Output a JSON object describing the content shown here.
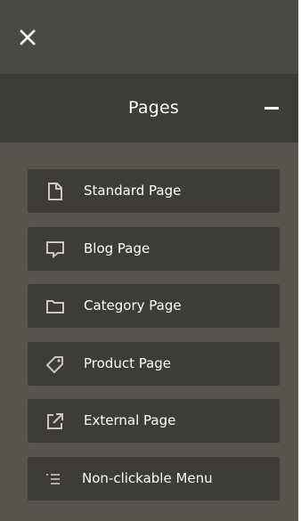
{
  "colors": {
    "panel_bg": "#56544d",
    "topbar_bg": "#4b4943",
    "header_bg": "#3e3c37",
    "item_bg": "#3e3c37",
    "text": "#ffffff",
    "icon": "#c9c7c0"
  },
  "topbar": {
    "close_icon": "close-icon"
  },
  "section": {
    "title": "Pages",
    "toggle_icon": "minus-icon"
  },
  "menu": {
    "items": [
      {
        "label": "Standard Page",
        "icon": "document-icon"
      },
      {
        "label": "Blog Page",
        "icon": "speech-bubble-icon"
      },
      {
        "label": "Category Page",
        "icon": "folder-icon"
      },
      {
        "label": "Product Page",
        "icon": "tag-icon"
      },
      {
        "label": "External Page",
        "icon": "external-link-icon"
      },
      {
        "label": "Non-clickable Menu",
        "icon": "indented-list-icon"
      }
    ]
  }
}
